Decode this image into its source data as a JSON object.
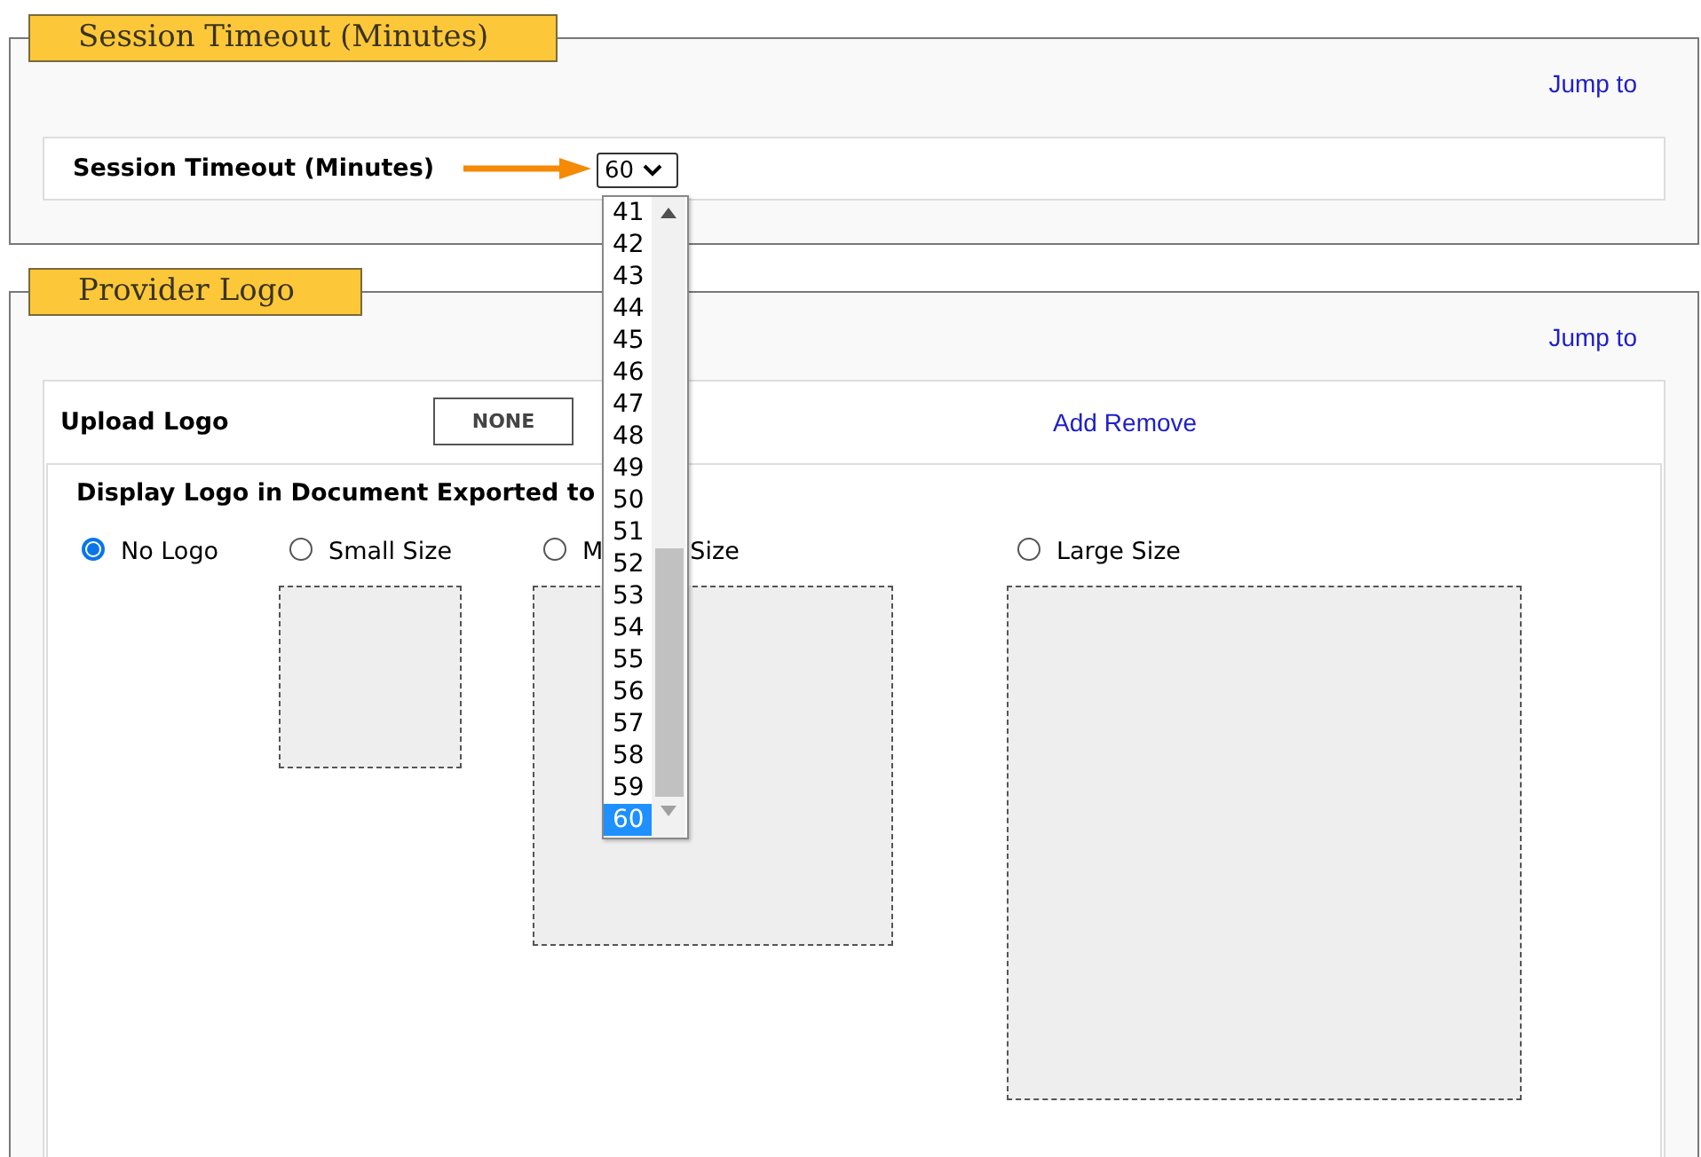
{
  "session_timeout": {
    "legend": "Session Timeout (Minutes)",
    "jump_link": "Jump to",
    "label": "Session Timeout (Minutes)",
    "select_value": "60",
    "dropdown_options": [
      {
        "label": "41",
        "selected": false
      },
      {
        "label": "42",
        "selected": false
      },
      {
        "label": "43",
        "selected": false
      },
      {
        "label": "44",
        "selected": false
      },
      {
        "label": "45",
        "selected": false
      },
      {
        "label": "46",
        "selected": false
      },
      {
        "label": "47",
        "selected": false
      },
      {
        "label": "48",
        "selected": false
      },
      {
        "label": "49",
        "selected": false
      },
      {
        "label": "50",
        "selected": false
      },
      {
        "label": "51",
        "selected": false
      },
      {
        "label": "52",
        "selected": false
      },
      {
        "label": "53",
        "selected": false
      },
      {
        "label": "54",
        "selected": false
      },
      {
        "label": "55",
        "selected": false
      },
      {
        "label": "56",
        "selected": false
      },
      {
        "label": "57",
        "selected": false
      },
      {
        "label": "58",
        "selected": false
      },
      {
        "label": "59",
        "selected": false
      },
      {
        "label": "60",
        "selected": true
      }
    ]
  },
  "provider_logo": {
    "legend": "Provider Logo",
    "jump_link": "Jump to",
    "upload_label": "Upload Logo",
    "upload_button": "NONE",
    "links": [
      "Add",
      "Remove"
    ],
    "display_title": "Display Logo in Document Exported to",
    "size_options": [
      {
        "label_parts": [
          "No Logo"
        ],
        "selected": true,
        "kind": "none"
      },
      {
        "label_parts": [
          "Small Size"
        ],
        "selected": false,
        "kind": "small"
      },
      {
        "label_parts": [
          "M",
          "Size"
        ],
        "selected": false,
        "kind": "medium"
      },
      {
        "label_parts": [
          "Large Size"
        ],
        "selected": false,
        "kind": "large"
      }
    ]
  }
}
